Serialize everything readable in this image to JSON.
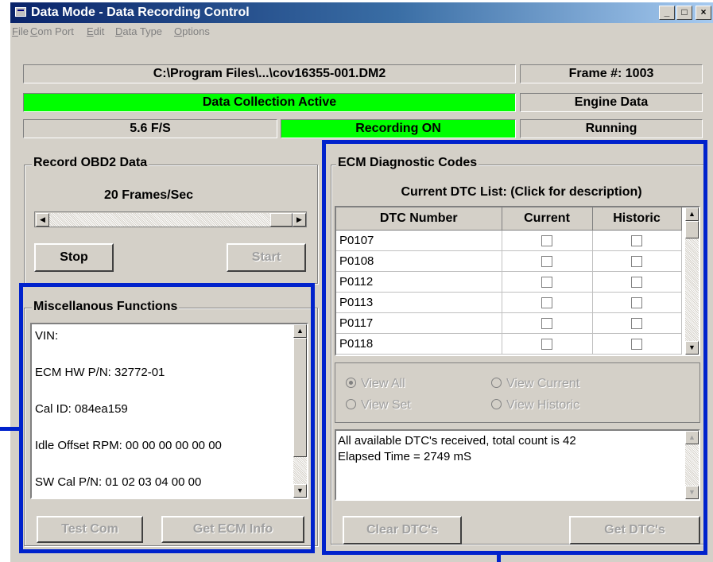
{
  "window": {
    "title": "Data Mode - Data Recording Control",
    "controls": {
      "minimize": "_",
      "maximize": "□",
      "close": "×"
    }
  },
  "menu": [
    "File",
    "Com Port",
    "Edit",
    "Data Type",
    "Options"
  ],
  "status": {
    "file_path": "C:\\Program Files\\...\\cov16355-001.DM2",
    "frame": "Frame #: 1003",
    "collection": "Data Collection Active",
    "data_kind": "Engine Data",
    "rate": "5.6 F/S",
    "recording": "Recording ON",
    "state": "Running"
  },
  "record": {
    "group_label": "Record OBD2 Data",
    "frames_label": "20 Frames/Sec",
    "stop_label": "Stop",
    "start_label": "Start"
  },
  "misc": {
    "group_label": "Miscellanous Functions",
    "lines": [
      "VIN:",
      "ECM HW P/N:  32772-01",
      "Cal ID:  084ea159",
      "Idle Offset RPM:  00 00 00 00 00 00",
      "SW Cal P/N:  01 02 03 04 00 00"
    ],
    "test_com_label": "Test Com",
    "get_ecm_label": "Get ECM Info"
  },
  "ecm": {
    "group_label": "ECM Diagnostic Codes",
    "list_caption": "Current DTC List: (Click for description)",
    "columns": [
      "DTC Number",
      "Current",
      "Historic"
    ],
    "rows": [
      "P0107",
      "P0108",
      "P0112",
      "P0113",
      "P0117",
      "P0118"
    ],
    "radios": {
      "view_all": "View All",
      "view_current": "View Current",
      "view_set": "View Set",
      "view_historic": "View Historic"
    },
    "selected_view": "View All",
    "log_lines": [
      "All available DTC's received, total count is 42",
      "Elapsed Time = 2749 mS"
    ],
    "clear_label": "Clear DTC's",
    "get_label": "Get DTC's"
  },
  "colors": {
    "active_green": "#00ff00",
    "highlight_blue": "#0022cc",
    "title_gradient_start": "#0a246a"
  }
}
